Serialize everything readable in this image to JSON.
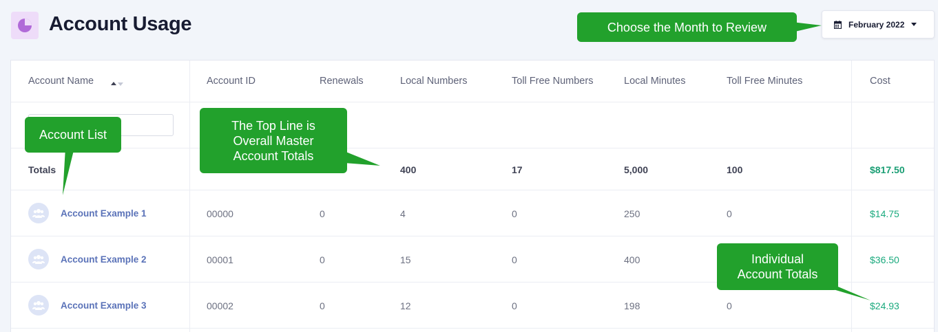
{
  "header": {
    "title": "Account Usage",
    "month_label": "February 2022"
  },
  "table": {
    "columns": [
      "Account Name",
      "Account ID",
      "Renewals",
      "Local Numbers",
      "Toll Free Numbers",
      "Local Minutes",
      "Toll Free Minutes",
      "Cost"
    ],
    "totals": {
      "label": "Totals",
      "local_numbers": "400",
      "toll_free_numbers": "17",
      "local_minutes": "5,000",
      "toll_free_minutes": "100",
      "cost": "$817.50"
    },
    "rows": [
      {
        "name": "Account Example 1",
        "id": "00000",
        "renewals": "0",
        "local_numbers": "4",
        "toll_free_numbers": "0",
        "local_minutes": "250",
        "toll_free_minutes": "0",
        "cost": "$14.75"
      },
      {
        "name": "Account Example 2",
        "id": "00001",
        "renewals": "0",
        "local_numbers": "15",
        "toll_free_numbers": "0",
        "local_minutes": "400",
        "toll_free_minutes": "",
        "cost": "$36.50"
      },
      {
        "name": "Account Example 3",
        "id": "00002",
        "renewals": "0",
        "local_numbers": "12",
        "toll_free_numbers": "0",
        "local_minutes": "198",
        "toll_free_minutes": "0",
        "cost": "$24.93"
      }
    ]
  },
  "callouts": {
    "month": "Choose the Month to Review",
    "account_list": "Account List",
    "top_line": [
      "The Top Line is",
      "Overall Master",
      "Account Totals"
    ],
    "individual": [
      "Individual",
      "Account Totals"
    ]
  },
  "colors": {
    "callout_green": "#22a12c",
    "cost_green": "#1baa7e",
    "link_blue": "#5a72b8"
  },
  "icons": [
    "pie-chart-icon",
    "calendar-icon",
    "caret-down-icon",
    "sort-icon",
    "user-group-icon"
  ]
}
